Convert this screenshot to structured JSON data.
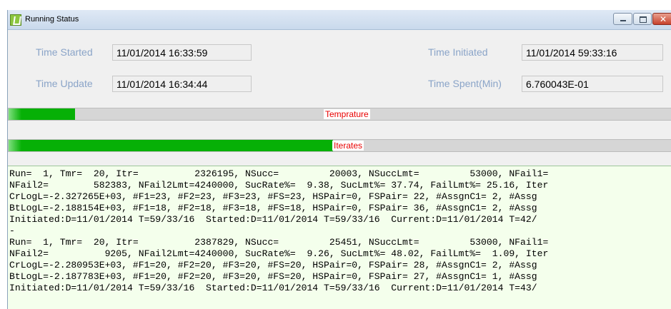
{
  "window": {
    "title": "Running Status",
    "controls": {
      "minimize": "minimize",
      "maximize": "maximize",
      "close": "close"
    }
  },
  "fields": {
    "time_started": {
      "label": "Time Started",
      "value": "11/01/2014 16:33:59"
    },
    "time_update": {
      "label": "Time Update",
      "value": "11/01/2014 16:34:44"
    },
    "time_initiated": {
      "label": "Time Initiated",
      "value": "11/01/2014  59:33:16"
    },
    "time_spent": {
      "label": "Time Spent(Min)",
      "value": "6.760043E-01"
    }
  },
  "progress": {
    "temperature": {
      "label": "Temprature",
      "fraction": 0.1
    },
    "iterates": {
      "label": "Iterates",
      "fraction": 0.49
    }
  },
  "log": {
    "lines": [
      "Run=  1, Tmr=  20, Itr=          2326195, NSucc=         20003, NSuccLmt=         53000, NFail1=",
      "NFail2=        582383, NFail2Lmt=4240000, SucRate%=  9.38, SucLmt%= 37.74, FailLmt%= 25.16, Iter",
      "CrLogL=-2.327265E+03, #F1=23, #F2=23, #F3=23, #FS=23, HSPair=0, FSPair= 22, #AssgnC1= 2, #Assg",
      "BtLogL=-2.188154E+03, #F1=18, #F2=18, #F3=18, #FS=18, HSPair=0, FSPair= 36, #AssgnC1= 2, #Assg",
      "Initiated:D=11/01/2014 T=59/33/16  Started:D=11/01/2014 T=59/33/16  Current:D=11/01/2014 T=42/",
      "-",
      "Run=  1, Tmr=  20, Itr=          2387829, NSucc=         25451, NSuccLmt=         53000, NFail1=",
      "NFail2=          9205, NFail2Lmt=4240000, SucRate%=  9.26, SucLmt%= 48.02, FailLmt%=  1.09, Iter",
      "CrLogL=-2.280953E+03, #F1=20, #F2=20, #F3=20, #FS=20, HSPair=0, FSPair= 28, #AssgnC1= 2, #Assg",
      "BtLogL=-2.187783E+03, #F1=20, #F2=20, #F3=20, #FS=20, HSPair=0, FSPair= 27, #AssgnC1= 1, #Assg",
      "Initiated:D=11/01/2014 T=59/33/16  Started:D=11/01/2014 T=59/33/16  Current:D=11/01/2014 T=43/"
    ]
  },
  "colors": {
    "label_text": "#8aa4c8",
    "progress_fill": "#06b006",
    "progress_label_text": "#e80000",
    "log_background": "#f4ffec"
  }
}
